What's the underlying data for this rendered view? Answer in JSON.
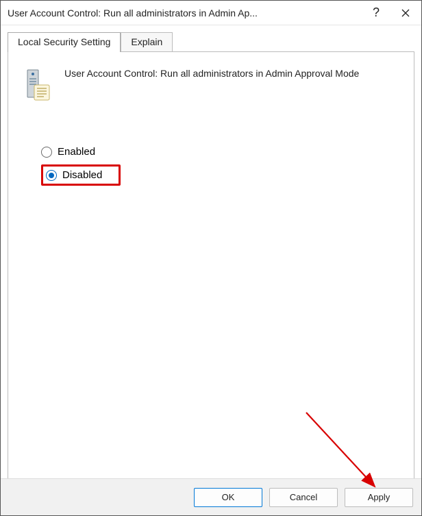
{
  "window": {
    "title": "User Account Control: Run all administrators in Admin Ap..."
  },
  "tabs": {
    "setting_label": "Local Security Setting",
    "explain_label": "Explain"
  },
  "policy": {
    "description": "User Account Control: Run all administrators in Admin Approval Mode"
  },
  "options": {
    "enabled_label": "Enabled",
    "disabled_label": "Disabled"
  },
  "buttons": {
    "ok": "OK",
    "cancel": "Cancel",
    "apply": "Apply"
  }
}
